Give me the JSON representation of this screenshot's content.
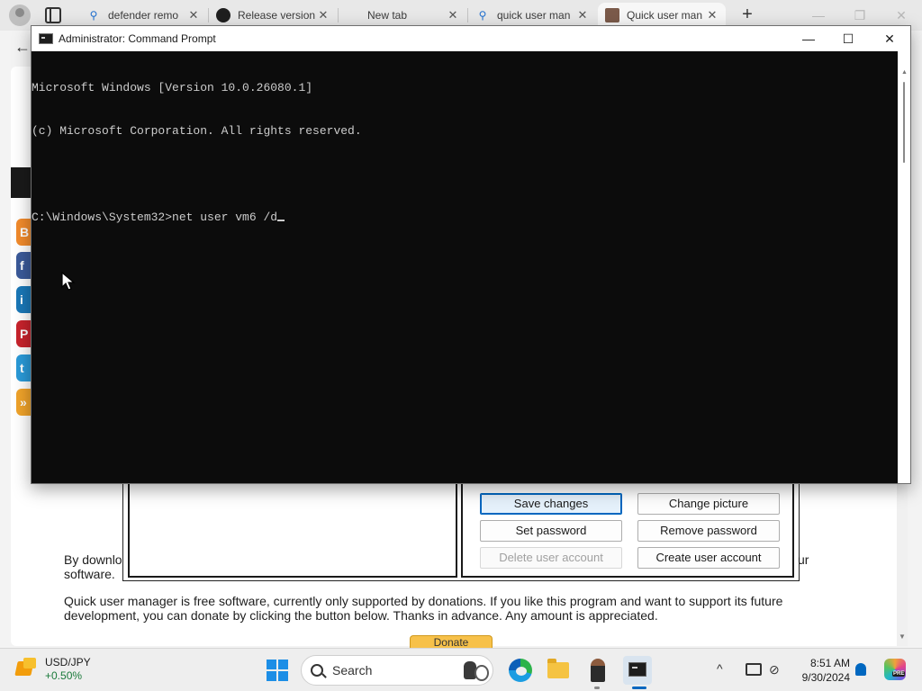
{
  "browser": {
    "tabs": [
      {
        "title": "defender remo",
        "icon": "search-icon",
        "active": false
      },
      {
        "title": "Release version",
        "icon": "github-icon",
        "active": false
      },
      {
        "title": "New tab",
        "icon": "",
        "active": false
      },
      {
        "title": "quick user man",
        "icon": "search-icon",
        "active": false
      },
      {
        "title": "Quick user man",
        "icon": "quick-user-manager-icon",
        "active": true
      }
    ],
    "new_tab_glyph": "+",
    "back_glyph": "←",
    "tab_close_glyph": "✕"
  },
  "page": {
    "download_text": "By downlo",
    "download_text_tail": "ur",
    "download_text_2": "software.",
    "donation_text": "Quick user manager is free software, currently only supported by donations. If you like this program and want to support its future development, you can donate by clicking the button below. Thanks in advance. Any amount is appreciated.",
    "donate_label": "Donate"
  },
  "qum": {
    "buttons": {
      "save_changes": "Save changes",
      "change_picture": "Change picture",
      "set_password": "Set password",
      "remove_password": "Remove password",
      "delete_user_account": "Delete user account",
      "create_user_account": "Create user account"
    }
  },
  "cmd": {
    "title": "Administrator: Command Prompt",
    "minimize_glyph": "—",
    "maximize_glyph": "☐",
    "close_glyph": "✕",
    "lines": [
      "Microsoft Windows [Version 10.0.26080.1]",
      "(c) Microsoft Corporation. All rights reserved.",
      "",
      "C:\\Windows\\System32>net user vm6 /d"
    ]
  },
  "taskbar": {
    "widget_name": "USD/JPY",
    "widget_change": "+0.50%",
    "search_label": "Search",
    "time": "8:51 AM",
    "date": "9/30/2024",
    "colors": {
      "accent": "#0067c0",
      "widget_positive": "#1a7a3a"
    }
  }
}
